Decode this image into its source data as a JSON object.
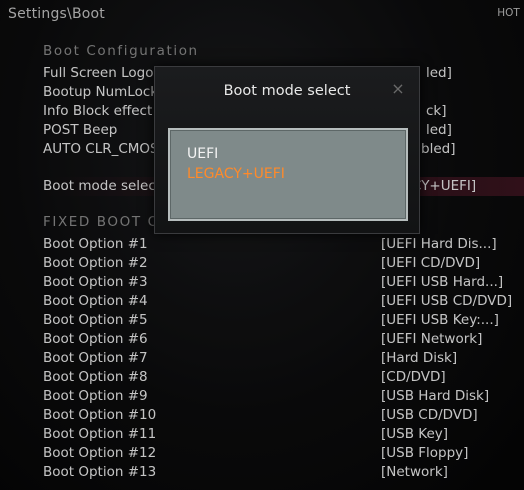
{
  "header": {
    "breadcrumb": "Settings\\Boot",
    "hotkey_hint": "HOT K"
  },
  "boot_configuration": {
    "title": "Boot Configuration",
    "items": [
      {
        "label": "Full Screen Logo",
        "value": "led]"
      },
      {
        "label": "Bootup NumLock",
        "value": ""
      },
      {
        "label": "Info Block effect",
        "value": "ck]"
      },
      {
        "label": "POST Beep",
        "value": "led]"
      },
      {
        "label": "AUTO CLR_CMOS",
        "value": "bled]"
      }
    ]
  },
  "boot_mode_row": {
    "label": "Boot mode selec",
    "value": "CY+UEFI]"
  },
  "fixed_boot": {
    "title": "FIXED BOOT O",
    "options": [
      {
        "label": "Boot Option #1",
        "value": "[UEFI Hard Dis...]"
      },
      {
        "label": "Boot Option #2",
        "value": "[UEFI CD/DVD]"
      },
      {
        "label": "Boot Option #3",
        "value": "[UEFI USB Hard...]"
      },
      {
        "label": "Boot Option #4",
        "value": "[UEFI USB CD/DVD]"
      },
      {
        "label": "Boot Option #5",
        "value": "[UEFI USB Key:...]"
      },
      {
        "label": "Boot Option #6",
        "value": "[UEFI Network]"
      },
      {
        "label": "Boot Option #7",
        "value": "[Hard Disk]"
      },
      {
        "label": "Boot Option #8",
        "value": "[CD/DVD]"
      },
      {
        "label": "Boot Option #9",
        "value": "[USB Hard Disk]"
      },
      {
        "label": "Boot Option #10",
        "value": "[USB CD/DVD]"
      },
      {
        "label": "Boot Option #11",
        "value": "[USB Key]"
      },
      {
        "label": "Boot Option #12",
        "value": "[USB Floppy]"
      },
      {
        "label": "Boot Option #13",
        "value": "[Network]"
      }
    ]
  },
  "dialog": {
    "title": "Boot mode select",
    "close_glyph": "×",
    "options": [
      "UEFI",
      "LEGACY+UEFI"
    ],
    "current_option": "LEGACY+UEFI"
  },
  "colors": {
    "current_option": "#ff8a2a",
    "option_box_bg": "#7f8a8a",
    "selected_row": "#501828"
  }
}
